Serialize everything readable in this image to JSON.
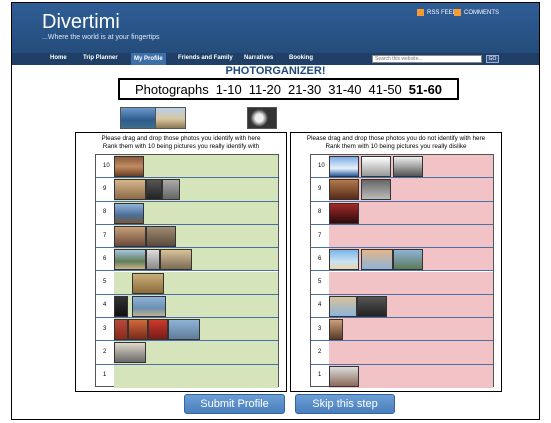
{
  "header": {
    "logo": "Divertimi",
    "tagline": "...Where the world is at your fingertips",
    "rss_feed": "RSS FEED",
    "comments": "COMMENTS"
  },
  "nav": {
    "items": [
      "Home",
      "Trip Planner",
      "My Profile",
      "Friends and Family",
      "Narratives",
      "Booking"
    ],
    "active": "My Profile",
    "search_placeholder": "Search this website...",
    "go": "GO"
  },
  "title": "PHOTORGANIZER!",
  "photo_tabs": {
    "label": "Photographs",
    "ranges": [
      "1-10",
      "11-20",
      "21-30",
      "31-40",
      "41-50",
      "51-60"
    ],
    "active": "51-60"
  },
  "left_panel": {
    "line1": "Please drag and drop those photos you identify with  here",
    "line2": "Rank them with 10 being pictures you really identify with",
    "rank_labels": [
      "10",
      "9",
      "8",
      "7",
      "6",
      "5",
      "4",
      "3",
      "2",
      "1"
    ],
    "color": "#d6e4bc"
  },
  "right_panel": {
    "line1": "Please drag and drop those photos you do not identify with here",
    "line2": "Rank them with 10 being pictures you really dislike",
    "rank_labels": [
      "10",
      "9",
      "8",
      "7",
      "6",
      "5",
      "4",
      "3",
      "2",
      "1"
    ],
    "color": "#f2c3c6"
  },
  "buttons": {
    "submit": "Submit Profile",
    "skip": "Skip this step"
  }
}
